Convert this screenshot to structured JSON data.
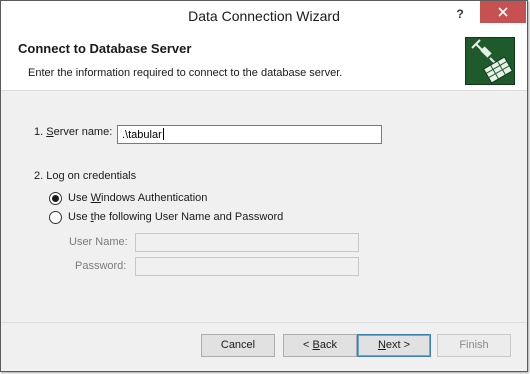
{
  "window": {
    "title": "Data Connection Wizard",
    "help_glyph": "?",
    "close_icon": "close-icon",
    "close_color": "#c75050"
  },
  "header": {
    "title": "Connect to Database Server",
    "description": "Enter the information required to connect to the database server.",
    "icon": "database-connection-icon",
    "icon_color": "#1f5a2d"
  },
  "server": {
    "label_prefix": "1. ",
    "label_mnemonic": "S",
    "label_rest": "erver name:",
    "value": ".\\tabular"
  },
  "credentials": {
    "section_label": "2. Log on credentials",
    "option_windows": {
      "before": "Use ",
      "mnemonic": "W",
      "after": "indows Authentication",
      "checked": true
    },
    "option_userpass": {
      "before": "Use ",
      "mnemonic": "t",
      "after": "he following User Name and Password",
      "checked": false
    },
    "username_label": "User Name:",
    "password_label": "Password:"
  },
  "buttons": {
    "cancel": "Cancel",
    "back_prefix": "< ",
    "back_mnemonic": "B",
    "back_rest": "ack",
    "next_mnemonic": "N",
    "next_rest": "ext >",
    "finish": "Finish"
  }
}
